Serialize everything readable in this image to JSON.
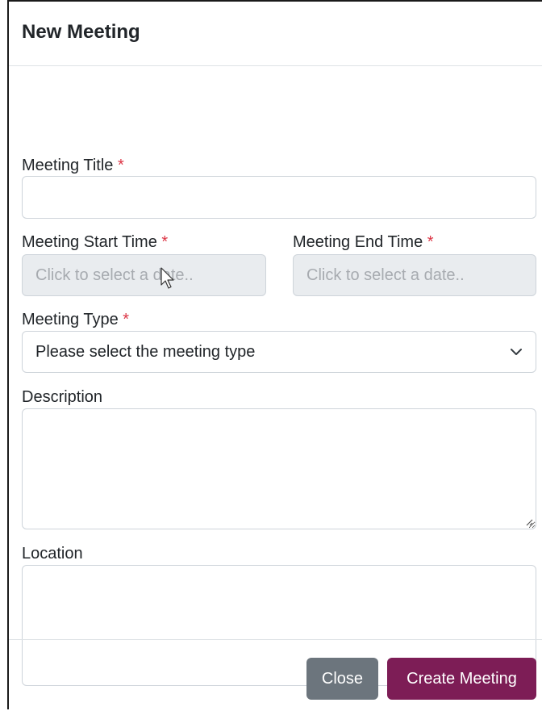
{
  "modal": {
    "title": "New Meeting"
  },
  "form": {
    "required_mark": "*",
    "meeting_title": {
      "label": "Meeting Title",
      "value": ""
    },
    "start_time": {
      "label": "Meeting Start Time",
      "placeholder": "Click to select a date.."
    },
    "end_time": {
      "label": "Meeting End Time",
      "placeholder": "Click to select a date.."
    },
    "meeting_type": {
      "label": "Meeting Type",
      "selected": "Please select the meeting type"
    },
    "description": {
      "label": "Description",
      "value": ""
    },
    "location": {
      "label": "Location",
      "value": ""
    }
  },
  "footer": {
    "close_label": "Close",
    "create_label": "Create Meeting"
  },
  "colors": {
    "required": "#dc3545",
    "close_button": "#6c757d",
    "create_button": "#7d1d56",
    "disabled_field": "#e9ecef"
  },
  "icons": {
    "select": "chevron-down-icon",
    "textarea": "resize-grip-icon",
    "pointer": "mouse-cursor-icon"
  }
}
